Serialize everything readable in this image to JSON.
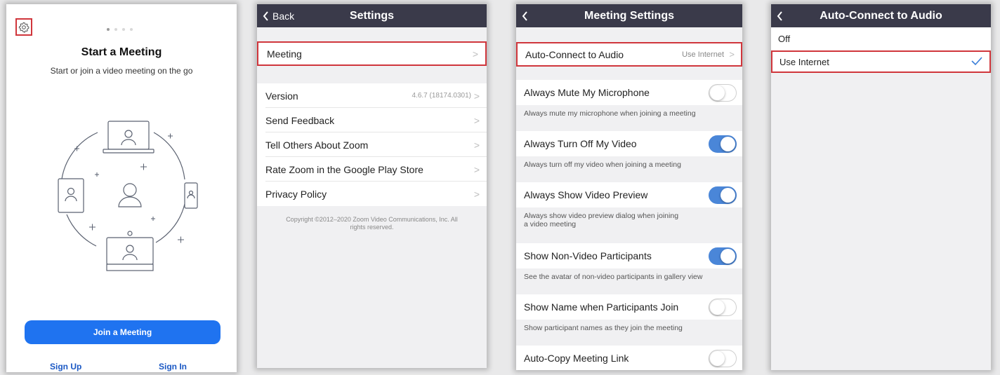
{
  "panel1": {
    "title": "Start a Meeting",
    "subtitle": "Start or join a video meeting on the go",
    "join_button": "Join a Meeting",
    "sign_up": "Sign Up",
    "sign_in": "Sign In",
    "page_indicator": {
      "count": 4,
      "active": 1
    }
  },
  "panel2": {
    "back_label": "Back",
    "title": "Settings",
    "rows": [
      {
        "label": "Meeting"
      },
      {
        "label": "Version",
        "value": "4.6.7 (18174.0301)"
      },
      {
        "label": "Send Feedback"
      },
      {
        "label": "Tell Others About Zoom"
      },
      {
        "label": "Rate Zoom in the Google Play Store"
      },
      {
        "label": "Privacy Policy"
      }
    ],
    "copyright": "Copyright ©2012–2020 Zoom Video Communications, Inc. All rights reserved."
  },
  "panel3": {
    "title": "Meeting Settings",
    "auto_connect": {
      "label": "Auto-Connect to Audio",
      "value": "Use Internet"
    },
    "settings": [
      {
        "label": "Always Mute My Microphone",
        "on": false,
        "desc": "Always mute my microphone when joining a meeting"
      },
      {
        "label": "Always Turn Off My Video",
        "on": true,
        "desc": "Always turn off my video when joining a meeting"
      },
      {
        "label": "Always Show Video Preview",
        "on": true,
        "desc_line1": "Always show video preview dialog when joining",
        "desc_line2": "a video meeting"
      },
      {
        "label": "Show Non-Video Participants",
        "on": true,
        "desc": "See the avatar of non-video participants in gallery view"
      },
      {
        "label": "Show Name when Participants Join",
        "on": false,
        "desc": "Show participant names as they join the meeting"
      },
      {
        "label": "Auto-Copy Meeting Link",
        "on": false
      }
    ]
  },
  "panel4": {
    "title": "Auto-Connect to Audio",
    "options": [
      {
        "label": "Off",
        "selected": false
      },
      {
        "label": "Use Internet",
        "selected": true
      }
    ]
  },
  "colors": {
    "nav_bar": "#3a3a4a",
    "accent_blue": "#1f73f0",
    "toggle_on": "#4a86d8",
    "highlight_red": "#d0363c",
    "link_blue": "#1a58c4"
  }
}
